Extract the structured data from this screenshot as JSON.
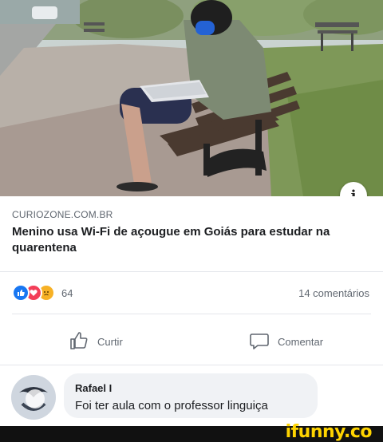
{
  "post": {
    "source_domain": "CURIOZONE.COM.BR",
    "headline": "Menino usa Wi-Fi de açougue em Goiás para estudar na quarentena",
    "info_icon": "i"
  },
  "stats": {
    "reactions": [
      "like",
      "love",
      "sad"
    ],
    "reaction_count": "64",
    "comment_count_label": "14 comentários"
  },
  "actions": {
    "like_label": "Curtir",
    "comment_label": "Comentar"
  },
  "comment": {
    "author": "Rafael I",
    "text": "Foi ter aula com o professor linguiça"
  },
  "watermark": {
    "brand": "ifunny.co"
  },
  "colors": {
    "like_blue": "#1877f2",
    "love_red": "#f33e58",
    "sad_yellow": "#f7b125",
    "brand_yellow": "#ffd400"
  }
}
